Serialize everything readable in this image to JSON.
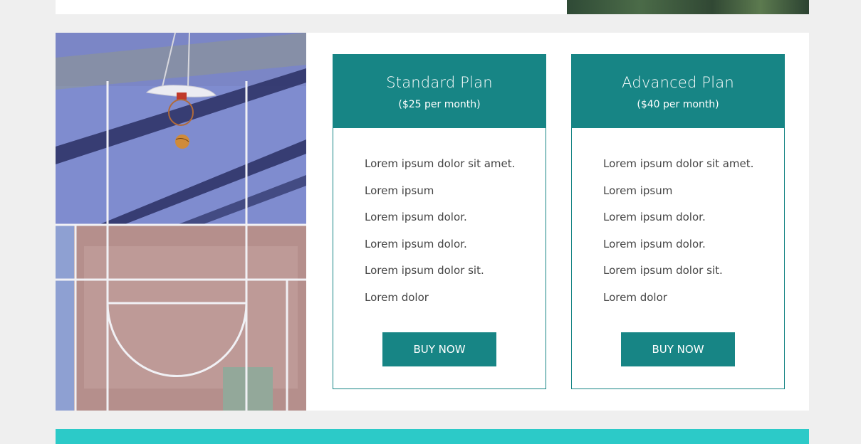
{
  "plans": [
    {
      "name": "Standard Plan",
      "price": "($25 per month)",
      "features": [
        "Lorem ipsum dolor sit amet.",
        "Lorem ipsum",
        "Lorem ipsum dolor.",
        "Lorem ipsum dolor.",
        "Lorem ipsum dolor sit.",
        "Lorem dolor"
      ],
      "button": "BUY NOW"
    },
    {
      "name": "Advanced Plan",
      "price": "($40 per month)",
      "features": [
        "Lorem ipsum dolor sit amet.",
        "Lorem ipsum",
        "Lorem ipsum dolor.",
        "Lorem ipsum dolor.",
        "Lorem ipsum dolor sit.",
        "Lorem dolor"
      ],
      "button": "BUY NOW"
    }
  ],
  "colors": {
    "accent": "#178585",
    "footer_band": "#2ccac8",
    "page_background": "#efefef"
  },
  "images": {
    "side_photo": "basketball-court-aerial-photo",
    "top_photo": "foliage-photo"
  }
}
